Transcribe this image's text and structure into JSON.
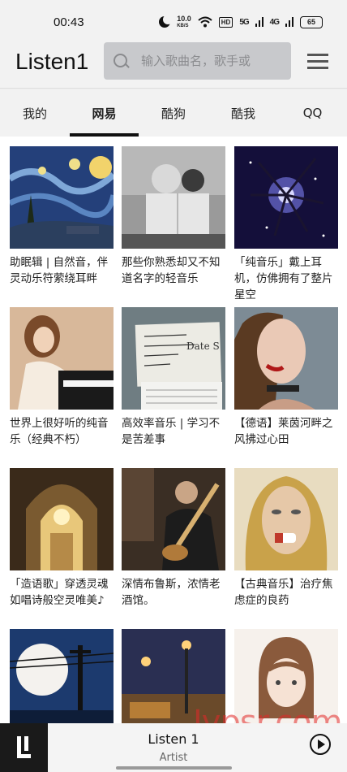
{
  "status_bar": {
    "time": "00:43",
    "net_speed": "10.0",
    "net_unit": "KB/S",
    "hd_label": "HD",
    "signal_1": "5G",
    "signal_2": "4G",
    "battery": "65"
  },
  "header": {
    "logo": "Listen1",
    "search_placeholder": "输入歌曲名，歌手或"
  },
  "tabs": [
    {
      "label": "我的",
      "active": false
    },
    {
      "label": "网易",
      "active": true
    },
    {
      "label": "酷狗",
      "active": false
    },
    {
      "label": "酷我",
      "active": false
    },
    {
      "label": "QQ",
      "active": false
    }
  ],
  "playlists": [
    {
      "title": "助眠辑 | 自然音，伴灵动乐符萦绕耳畔"
    },
    {
      "title": "那些你熟悉却又不知道名字的轻音乐"
    },
    {
      "title": "「纯音乐」戴上耳机，仿佛拥有了整片星空"
    },
    {
      "title": "世界上很好听的纯音乐（经典不朽）"
    },
    {
      "title": "高效率音乐 | 学习不是苦差事"
    },
    {
      "title": "【德语】莱茵河畔之风拂过心田"
    },
    {
      "title": "「造语歌」穿透灵魂 如唱诗般空灵唯美♪"
    },
    {
      "title": "深情布鲁斯，浓情老酒馆。"
    },
    {
      "title": "【古典音乐】治疗焦虑症的良药"
    },
    {
      "title": ""
    },
    {
      "title": ""
    },
    {
      "title": ""
    }
  ],
  "cover_art_text": {
    "handwritten": "Date S"
  },
  "player": {
    "title": "Listen 1",
    "artist": "Artist"
  },
  "watermark": "Ivpsr.com"
}
